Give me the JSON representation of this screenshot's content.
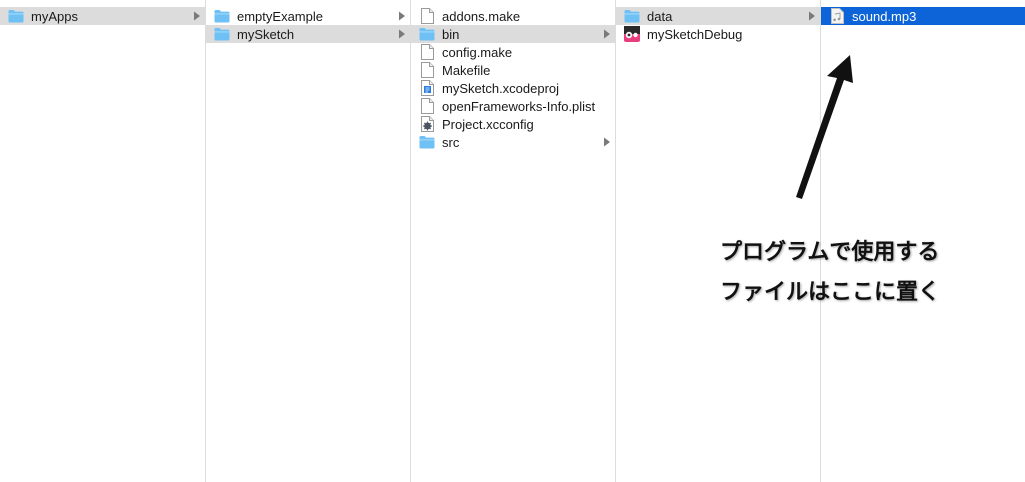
{
  "columns": [
    {
      "items": [
        {
          "label": "myApps",
          "icon": "folder-icon",
          "state": "path",
          "chevron": true
        }
      ]
    },
    {
      "items": [
        {
          "label": "emptyExample",
          "icon": "folder-icon",
          "state": "normal",
          "chevron": true
        },
        {
          "label": "mySketch",
          "icon": "folder-icon",
          "state": "path",
          "chevron": true
        }
      ]
    },
    {
      "items": [
        {
          "label": "addons.make",
          "icon": "document-icon",
          "state": "normal",
          "chevron": false
        },
        {
          "label": "bin",
          "icon": "folder-icon",
          "state": "path",
          "chevron": true
        },
        {
          "label": "config.make",
          "icon": "document-icon",
          "state": "normal",
          "chevron": false
        },
        {
          "label": "Makefile",
          "icon": "document-icon",
          "state": "normal",
          "chevron": false
        },
        {
          "label": "mySketch.xcodeproj",
          "icon": "xcodeproj-icon",
          "state": "normal",
          "chevron": false
        },
        {
          "label": "openFrameworks-Info.plist",
          "icon": "document-icon",
          "state": "normal",
          "chevron": false
        },
        {
          "label": "Project.xcconfig",
          "icon": "xcconfig-gear-icon",
          "state": "normal",
          "chevron": false
        },
        {
          "label": "src",
          "icon": "folder-icon",
          "state": "normal",
          "chevron": true
        }
      ]
    },
    {
      "items": [
        {
          "label": "data",
          "icon": "folder-icon",
          "state": "path",
          "chevron": true
        },
        {
          "label": "mySketchDebug",
          "icon": "app-icon",
          "state": "normal",
          "chevron": false
        }
      ]
    },
    {
      "items": [
        {
          "label": "sound.mp3",
          "icon": "audio-file-icon",
          "state": "active",
          "chevron": false
        }
      ]
    }
  ],
  "annotation": {
    "line1": "プログラムで使用する",
    "line2": "ファイルはここに置く"
  },
  "colors": {
    "selection": "#0d64d8",
    "path_highlight": "#dcdcdc",
    "folder": "#6ec0f5",
    "column_divider": "#dcdcdc"
  }
}
